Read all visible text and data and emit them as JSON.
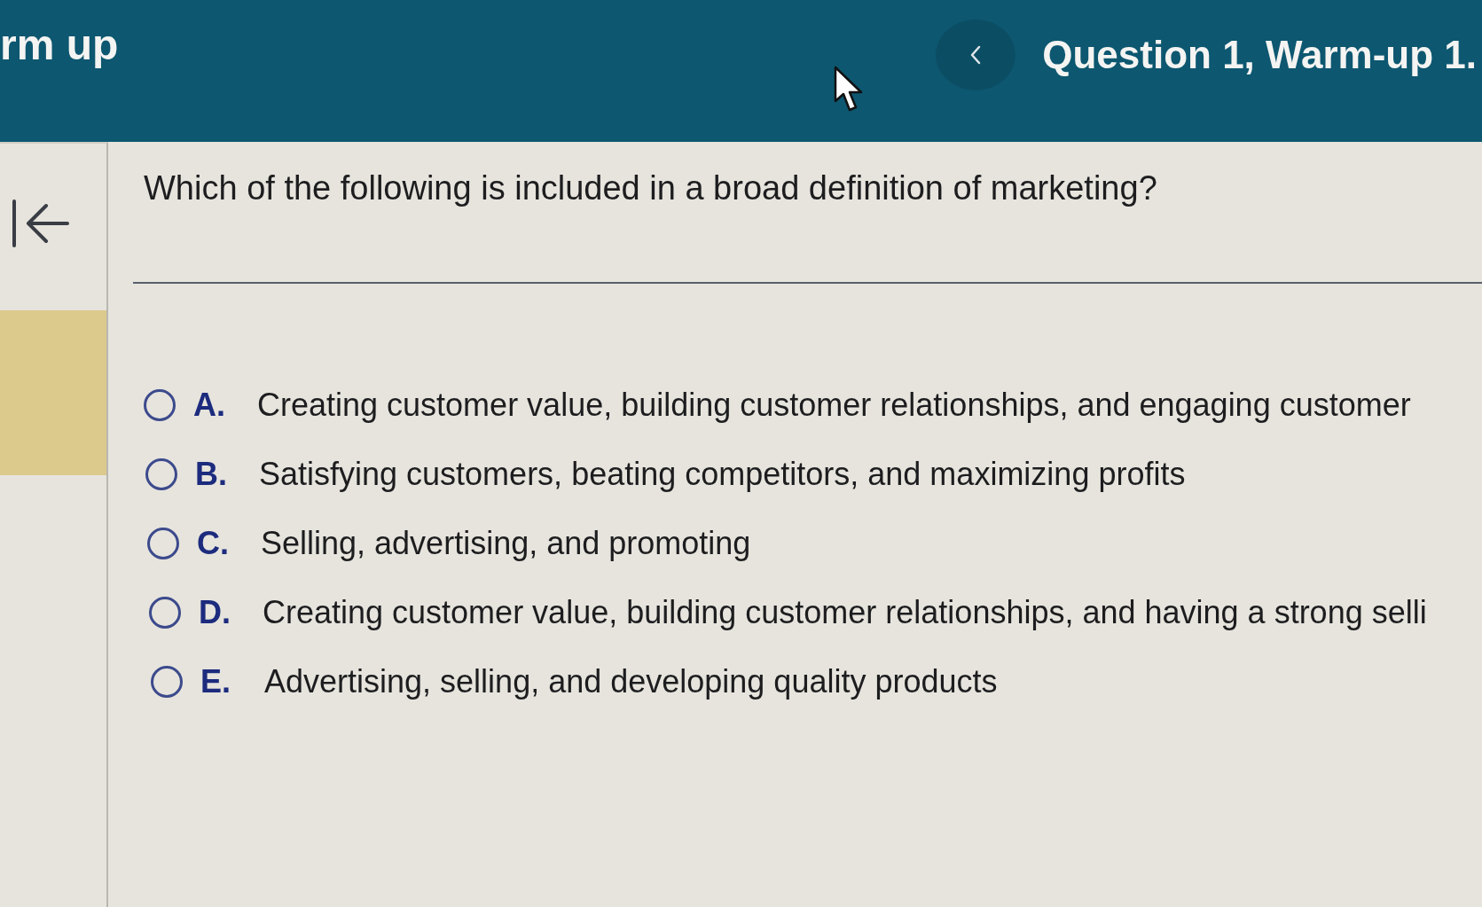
{
  "header": {
    "course_title": "rm up",
    "question_title": "Question 1, Warm-up 1."
  },
  "question": {
    "text": "Which of the following is included in a broad definition of marketing?"
  },
  "options": [
    {
      "letter": "A.",
      "text": "Creating customer value, building customer relationships, and engaging customer",
      "selected": false
    },
    {
      "letter": "B.",
      "text": "Satisfying customers, beating competitors, and maximizing profits",
      "selected": false
    },
    {
      "letter": "C.",
      "text": "Selling, advertising, and promoting",
      "selected": false
    },
    {
      "letter": "D.",
      "text": "Creating customer value, building customer relationships, and having a strong selli",
      "selected": false
    },
    {
      "letter": "E.",
      "text": "Advertising, selling, and developing quality products",
      "selected": false
    }
  ]
}
